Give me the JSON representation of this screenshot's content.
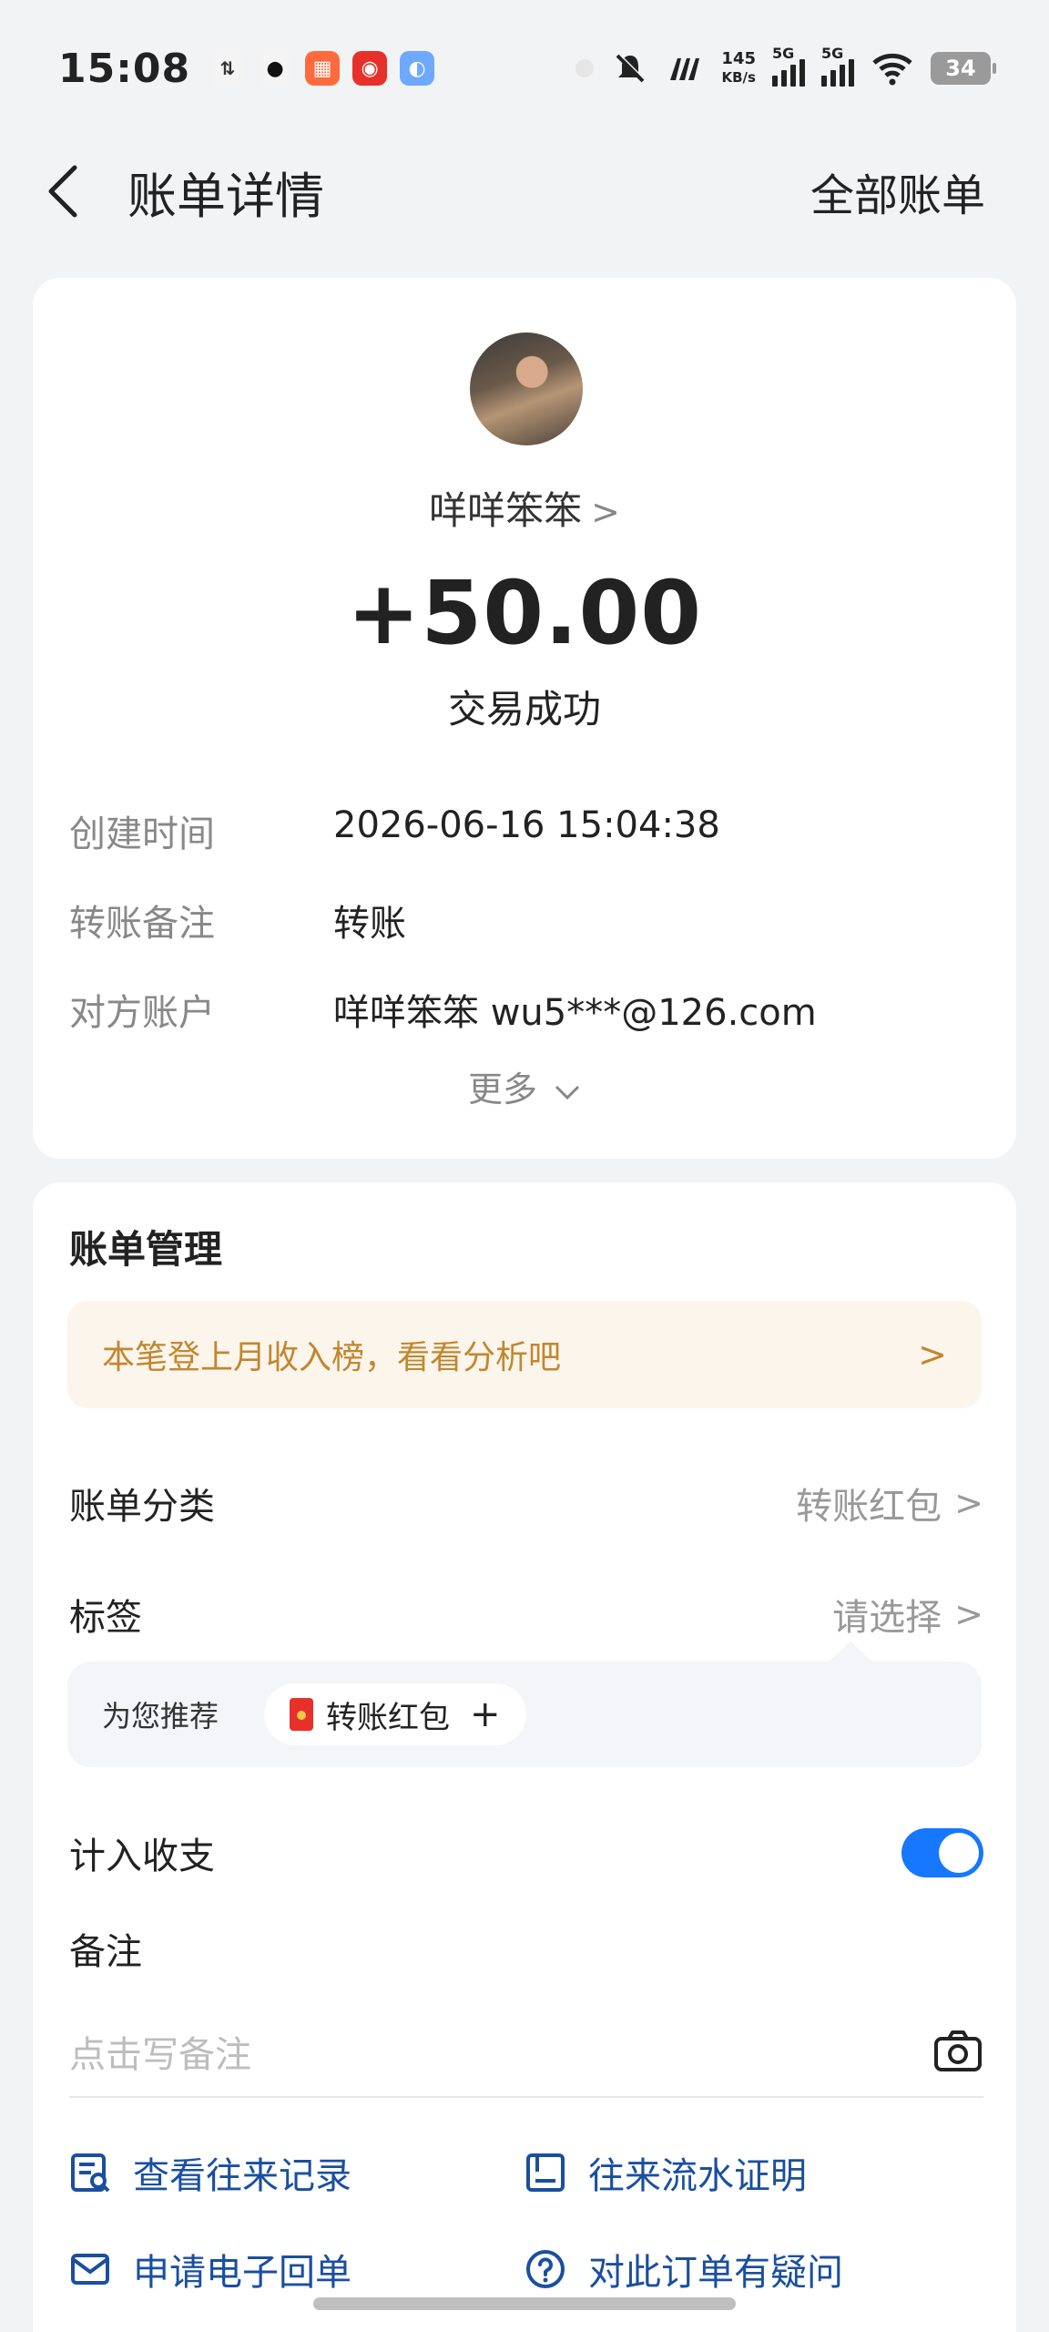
{
  "status_bar": {
    "time": "15:08",
    "net_speed_value": "145",
    "net_speed_unit": "KB/s",
    "signal_tag_1": "5G",
    "signal_tag_2": "5G",
    "battery": "34",
    "icons": [
      "sync-icon",
      "qq-icon",
      "app-icon",
      "red-app-icon",
      "assistant-icon",
      "dnd-icon",
      "mute-icon",
      "signal-icon",
      "wifi-icon",
      "battery-icon"
    ]
  },
  "header": {
    "title": "账单详情",
    "all_bills": "全部账单"
  },
  "transaction": {
    "payer_name": "咩咩笨笨",
    "amount": "+50.00",
    "status": "交易成功",
    "details": [
      {
        "label": "创建时间",
        "value": "2026-06-16 15:04:38"
      },
      {
        "label": "转账备注",
        "value": "转账"
      },
      {
        "label": "对方账户",
        "value": "咩咩笨笨 wu5***@126.com"
      }
    ],
    "more": "更多"
  },
  "management": {
    "title": "账单管理",
    "banner": "本笔登上月收入榜，看看分析吧",
    "category_label": "账单分类",
    "category_value": "转账红包",
    "tag_label": "标签",
    "tag_value": "请选择",
    "recommend_label": "为您推荐",
    "recommend_chip": "转账红包",
    "include_label": "计入收支",
    "include_enabled": true,
    "note_label": "备注",
    "note_placeholder": "点击写备注"
  },
  "links": {
    "records": "查看往来记录",
    "statement": "往来流水证明",
    "receipt": "申请电子回单",
    "question": "对此订单有疑问"
  },
  "colors": {
    "accent": "#1677ff",
    "link": "#1a4fa0",
    "banner_text": "#c2872f",
    "banner_bg": "#fbf5ec"
  }
}
